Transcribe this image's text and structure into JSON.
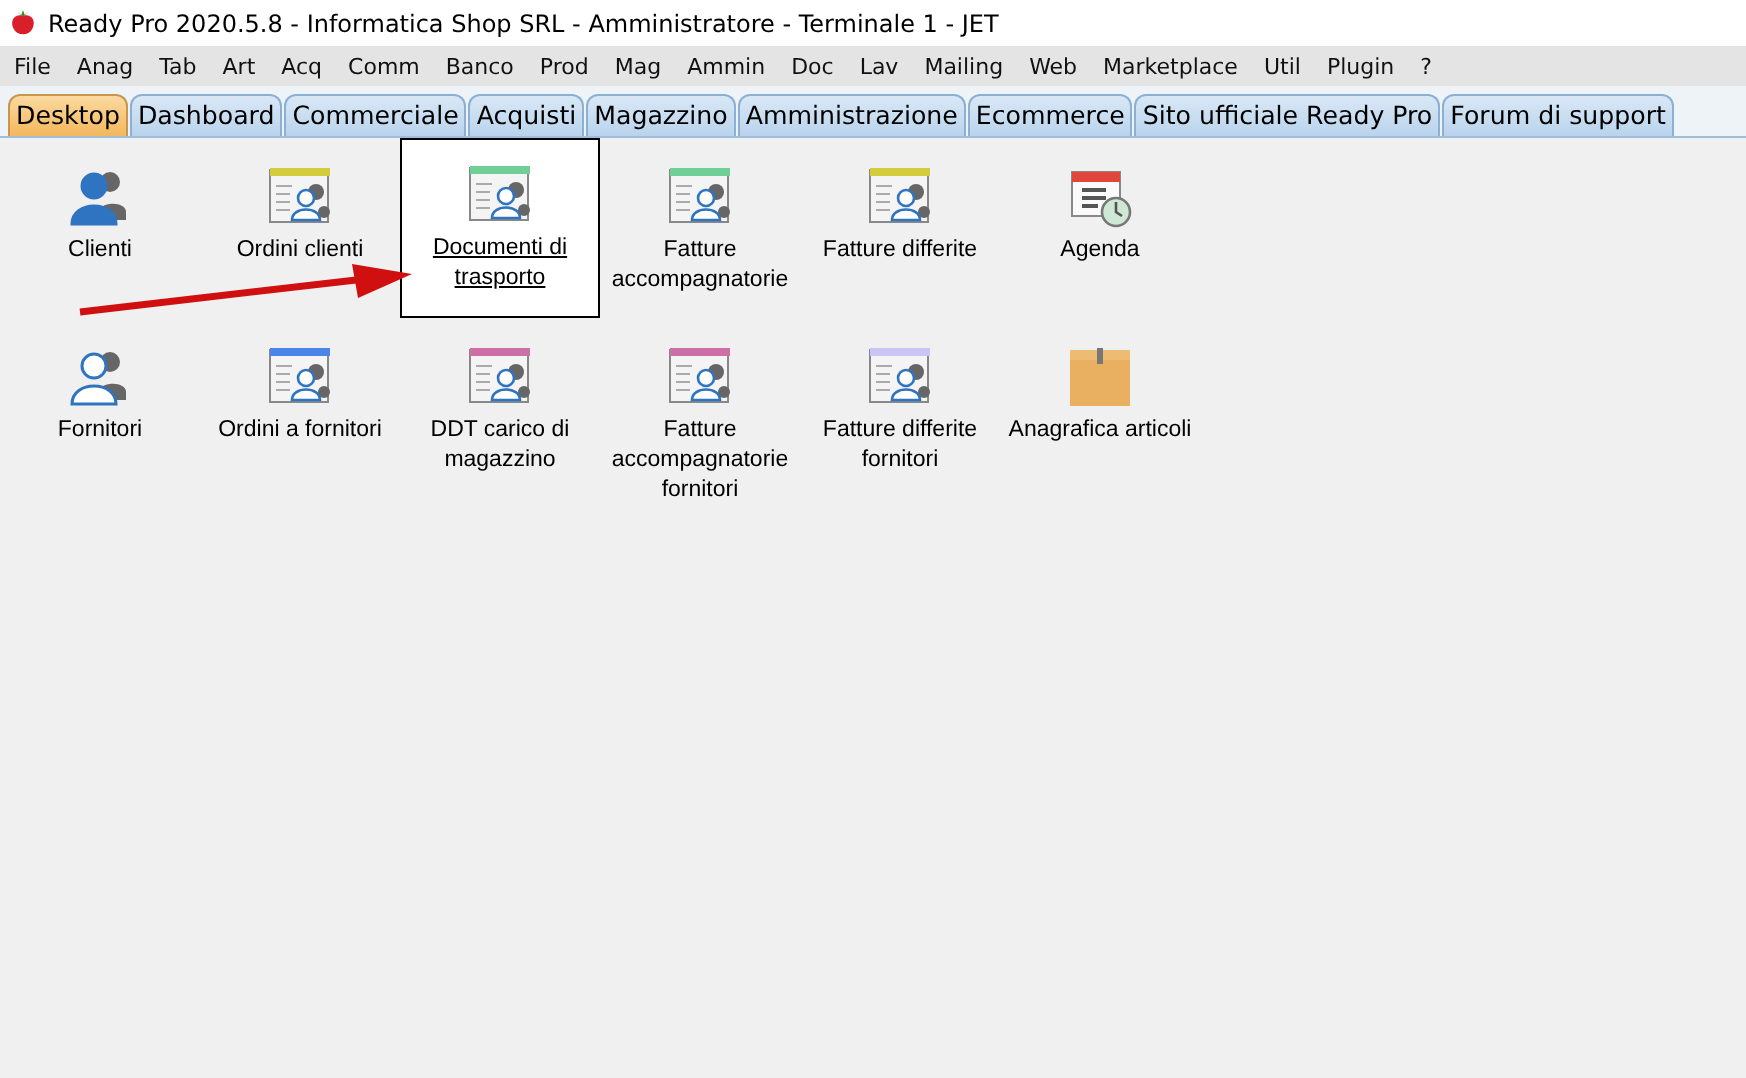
{
  "window": {
    "title": "Ready Pro 2020.5.8 - Informatica Shop SRL - Amministratore - Terminale 1 - JET"
  },
  "menu": [
    "File",
    "Anag",
    "Tab",
    "Art",
    "Acq",
    "Comm",
    "Banco",
    "Prod",
    "Mag",
    "Ammin",
    "Doc",
    "Lav",
    "Mailing",
    "Web",
    "Marketplace",
    "Util",
    "Plugin",
    "?"
  ],
  "tabs": [
    {
      "label": "Desktop",
      "selected": true
    },
    {
      "label": "Dashboard",
      "selected": false
    },
    {
      "label": "Commerciale",
      "selected": false
    },
    {
      "label": "Acquisti",
      "selected": false
    },
    {
      "label": "Magazzino",
      "selected": false
    },
    {
      "label": "Amministrazione",
      "selected": false
    },
    {
      "label": "Ecommerce",
      "selected": false
    },
    {
      "label": "Sito ufficiale Ready Pro",
      "selected": false
    },
    {
      "label": "Forum di support",
      "selected": false
    }
  ],
  "desktop_rows": [
    [
      {
        "label": "Clienti",
        "kind": "person",
        "selected": false
      },
      {
        "label": "Ordini clienti",
        "kind": "document",
        "color": "#d4cc3c",
        "selected": false
      },
      {
        "label": "Documenti di trasporto",
        "kind": "document",
        "color": "#6fcf97",
        "selected": true
      },
      {
        "label": "Fatture accompagnatorie",
        "kind": "document",
        "color": "#6fcf97",
        "selected": false
      },
      {
        "label": "Fatture differite",
        "kind": "document",
        "color": "#d4cc3c",
        "selected": false
      },
      {
        "label": "Agenda",
        "kind": "calendar",
        "selected": false
      }
    ],
    [
      {
        "label": "Fornitori",
        "kind": "person-outline",
        "selected": false
      },
      {
        "label": "Ordini a fornitori",
        "kind": "document",
        "color": "#4a86e8",
        "selected": false
      },
      {
        "label": "DDT carico di magazzino",
        "kind": "document",
        "color": "#cc6fa8",
        "selected": false
      },
      {
        "label": "Fatture accompagnatorie fornitori",
        "kind": "document",
        "color": "#cc6fa8",
        "selected": false
      },
      {
        "label": "Fatture differite fornitori",
        "kind": "document",
        "color": "#c9c6f5",
        "selected": false
      },
      {
        "label": "Anagrafica articoli",
        "kind": "box",
        "selected": false
      }
    ]
  ],
  "annotation_arrow": {
    "kind": "arrow"
  }
}
